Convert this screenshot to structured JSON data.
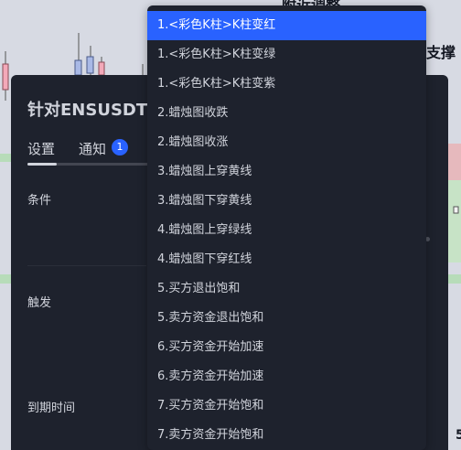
{
  "background_chart": {
    "top_label": "附近调整",
    "right_label": "支撑",
    "bottom_right_label": "5"
  },
  "dialog": {
    "title": "针对ENSUSDT的警报",
    "tabs": [
      {
        "label": "设置",
        "active": true
      },
      {
        "label": "通知",
        "badge": "1"
      }
    ],
    "fields": {
      "condition": "条件",
      "trigger": "触发",
      "expiration": "到期时间"
    }
  },
  "dropdown": {
    "selected_index": 0,
    "options": [
      "1.<彩色K柱>K柱变红",
      "1.<彩色K柱>K柱变绿",
      "1.<彩色K柱>K柱变紫",
      "2.蜡烛图收跌",
      "2.蜡烛图收涨",
      "3.蜡烛图上穿黄线",
      "3.蜡烛图下穿黄线",
      "4.蜡烛图上穿绿线",
      "4.蜡烛图下穿红线",
      "5.买方退出饱和",
      "5.卖方资金退出饱和",
      "6.买方资金开始加速",
      "6.卖方资金开始加速",
      "7.买方资金开始饱和",
      "7.卖方资金开始饱和"
    ]
  },
  "colors": {
    "accent": "#2962ff",
    "panel": "#1e222d",
    "text": "#d1d4dc",
    "chart_bg": "#d7dae3",
    "green_zone": "#b7dcb9",
    "red_zone": "#e6b9bd"
  }
}
